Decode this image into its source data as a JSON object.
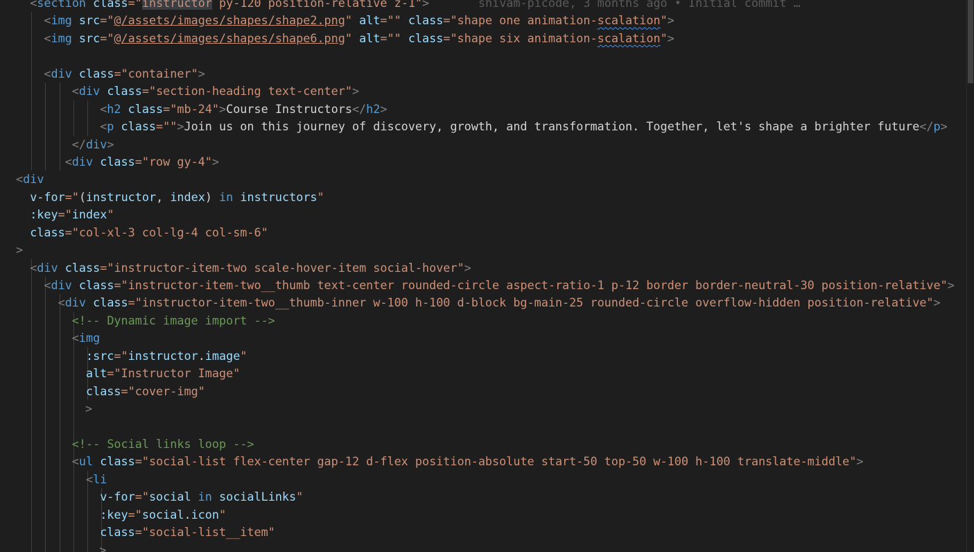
{
  "editor": {
    "language": "vue",
    "colors": {
      "background": "#1e1e1e",
      "tag": "#569cd6",
      "attribute": "#9cdcfe",
      "string": "#ce9178",
      "comment": "#6a9955",
      "punctuation": "#808080",
      "text": "#d4d4d4"
    },
    "lines": [
      {
        "indent": 1,
        "guides": 0,
        "tokens": [
          {
            "t": "<",
            "c": "punct"
          },
          {
            "t": "section",
            "c": "tag"
          },
          {
            "t": " ",
            "c": "txt"
          },
          {
            "t": "class",
            "c": "attr"
          },
          {
            "t": "=\"",
            "c": "str"
          },
          {
            "t": "instructor",
            "c": "str hl"
          },
          {
            "t": " py-120 position-relative z-1\"",
            "c": "str"
          },
          {
            "t": ">",
            "c": "punct"
          },
          {
            "t": "       shivam-picode, 3 months ago • Initial commit …",
            "c": "blame"
          }
        ]
      },
      {
        "indent": 2,
        "guides": 1,
        "tokens": [
          {
            "t": "<",
            "c": "punct"
          },
          {
            "t": "img",
            "c": "tag"
          },
          {
            "t": " ",
            "c": "txt"
          },
          {
            "t": "src",
            "c": "attr"
          },
          {
            "t": "=\"",
            "c": "str"
          },
          {
            "t": "@/assets/images/shapes/shape2.png",
            "c": "link"
          },
          {
            "t": "\"",
            "c": "str"
          },
          {
            "t": " ",
            "c": "txt"
          },
          {
            "t": "alt",
            "c": "attr"
          },
          {
            "t": "=\"\"",
            "c": "str"
          },
          {
            "t": " ",
            "c": "txt"
          },
          {
            "t": "class",
            "c": "attr"
          },
          {
            "t": "=\"shape one animation-",
            "c": "str"
          },
          {
            "t": "scalation",
            "c": "str squig"
          },
          {
            "t": "\"",
            "c": "str"
          },
          {
            "t": ">",
            "c": "punct"
          }
        ]
      },
      {
        "indent": 2,
        "guides": 1,
        "tokens": [
          {
            "t": "<",
            "c": "punct"
          },
          {
            "t": "img",
            "c": "tag"
          },
          {
            "t": " ",
            "c": "txt"
          },
          {
            "t": "src",
            "c": "attr"
          },
          {
            "t": "=\"",
            "c": "str"
          },
          {
            "t": "@/assets/images/shapes/shape6.png",
            "c": "link"
          },
          {
            "t": "\"",
            "c": "str"
          },
          {
            "t": " ",
            "c": "txt"
          },
          {
            "t": "alt",
            "c": "attr"
          },
          {
            "t": "=\"\"",
            "c": "str"
          },
          {
            "t": " ",
            "c": "txt"
          },
          {
            "t": "class",
            "c": "attr"
          },
          {
            "t": "=\"shape six animation-",
            "c": "str"
          },
          {
            "t": "scalation",
            "c": "str squig"
          },
          {
            "t": "\"",
            "c": "str"
          },
          {
            "t": ">",
            "c": "punct"
          }
        ]
      },
      {
        "indent": 0,
        "guides": 1,
        "tokens": []
      },
      {
        "indent": 2,
        "guides": 1,
        "tokens": [
          {
            "t": "<",
            "c": "punct"
          },
          {
            "t": "div",
            "c": "tag"
          },
          {
            "t": " ",
            "c": "txt"
          },
          {
            "t": "class",
            "c": "attr"
          },
          {
            "t": "=\"container\"",
            "c": "str"
          },
          {
            "t": ">",
            "c": "punct"
          }
        ]
      },
      {
        "indent": 4,
        "guides": 3,
        "tokens": [
          {
            "t": "<",
            "c": "punct"
          },
          {
            "t": "div",
            "c": "tag"
          },
          {
            "t": " ",
            "c": "txt"
          },
          {
            "t": "class",
            "c": "attr"
          },
          {
            "t": "=\"section-heading text-center\"",
            "c": "str"
          },
          {
            "t": ">",
            "c": "punct"
          }
        ]
      },
      {
        "indent": 6,
        "guides": 5,
        "tokens": [
          {
            "t": "<",
            "c": "punct"
          },
          {
            "t": "h2",
            "c": "tag"
          },
          {
            "t": " ",
            "c": "txt"
          },
          {
            "t": "class",
            "c": "attr"
          },
          {
            "t": "=\"mb-24\"",
            "c": "str"
          },
          {
            "t": ">",
            "c": "punct"
          },
          {
            "t": "Course Instructors",
            "c": "txt"
          },
          {
            "t": "</",
            "c": "punct"
          },
          {
            "t": "h2",
            "c": "tag"
          },
          {
            "t": ">",
            "c": "punct"
          }
        ]
      },
      {
        "indent": 6,
        "guides": 5,
        "tokens": [
          {
            "t": "<",
            "c": "punct"
          },
          {
            "t": "p",
            "c": "tag"
          },
          {
            "t": " ",
            "c": "txt"
          },
          {
            "t": "class",
            "c": "attr"
          },
          {
            "t": "=\"\"",
            "c": "str"
          },
          {
            "t": ">",
            "c": "punct"
          },
          {
            "t": "Join us on this journey of discovery, growth, and transformation. Together, let's shape a brighter future",
            "c": "txt"
          },
          {
            "t": "</",
            "c": "punct"
          },
          {
            "t": "p",
            "c": "tag"
          },
          {
            "t": ">",
            "c": "punct"
          }
        ]
      },
      {
        "indent": 4,
        "guides": 3,
        "tokens": [
          {
            "t": "</",
            "c": "punct"
          },
          {
            "t": "div",
            "c": "tag"
          },
          {
            "t": ">",
            "c": "punct"
          }
        ]
      },
      {
        "indent": 3.5,
        "guides": 3,
        "tokens": [
          {
            "t": "<",
            "c": "punct"
          },
          {
            "t": "div",
            "c": "tag"
          },
          {
            "t": " ",
            "c": "txt"
          },
          {
            "t": "class",
            "c": "attr"
          },
          {
            "t": "=\"row gy-4\"",
            "c": "str"
          },
          {
            "t": ">",
            "c": "punct"
          }
        ]
      },
      {
        "indent": 0,
        "guides": 0,
        "tokens": [
          {
            "t": "<",
            "c": "punct"
          },
          {
            "t": "div",
            "c": "tag"
          }
        ]
      },
      {
        "indent": 1,
        "guides": 0,
        "tokens": [
          {
            "t": "v-for",
            "c": "attr"
          },
          {
            "t": "=\"",
            "c": "str"
          },
          {
            "t": "(",
            "c": "txt"
          },
          {
            "t": "instructor",
            "c": "var"
          },
          {
            "t": ", ",
            "c": "txt"
          },
          {
            "t": "index",
            "c": "var"
          },
          {
            "t": ") ",
            "c": "txt"
          },
          {
            "t": "in",
            "c": "kw"
          },
          {
            "t": " ",
            "c": "txt"
          },
          {
            "t": "instructors",
            "c": "var"
          },
          {
            "t": "\"",
            "c": "str"
          }
        ]
      },
      {
        "indent": 1,
        "guides": 0,
        "tokens": [
          {
            "t": ":key",
            "c": "attr"
          },
          {
            "t": "=\"",
            "c": "str"
          },
          {
            "t": "index",
            "c": "var"
          },
          {
            "t": "\"",
            "c": "str"
          }
        ]
      },
      {
        "indent": 1,
        "guides": 0,
        "tokens": [
          {
            "t": "class",
            "c": "attr"
          },
          {
            "t": "=\"col-xl-3 col-lg-4 col-sm-6\"",
            "c": "str"
          }
        ]
      },
      {
        "indent": 0,
        "guides": 0,
        "tokens": [
          {
            "t": ">",
            "c": "punct"
          }
        ]
      },
      {
        "indent": 1,
        "guides": 1,
        "tokens": [
          {
            "t": "<",
            "c": "punct"
          },
          {
            "t": "div",
            "c": "tag"
          },
          {
            "t": " ",
            "c": "txt"
          },
          {
            "t": "class",
            "c": "attr"
          },
          {
            "t": "=\"instructor-item-two scale-hover-item social-hover\"",
            "c": "str"
          },
          {
            "t": ">",
            "c": "punct"
          }
        ]
      },
      {
        "indent": 2,
        "guides": 2,
        "tokens": [
          {
            "t": "<",
            "c": "punct"
          },
          {
            "t": "div",
            "c": "tag"
          },
          {
            "t": " ",
            "c": "txt"
          },
          {
            "t": "class",
            "c": "attr"
          },
          {
            "t": "=\"instructor-item-two__thumb text-center rounded-circle aspect-ratio-1 p-12 border border-neutral-30 position-relative\"",
            "c": "str"
          },
          {
            "t": ">",
            "c": "punct"
          }
        ]
      },
      {
        "indent": 3,
        "guides": 3,
        "tokens": [
          {
            "t": "<",
            "c": "punct"
          },
          {
            "t": "div",
            "c": "tag"
          },
          {
            "t": " ",
            "c": "txt"
          },
          {
            "t": "class",
            "c": "attr"
          },
          {
            "t": "=\"instructor-item-two__thumb-inner w-100 h-100 d-block bg-main-25 rounded-circle overflow-hidden position-relative\"",
            "c": "str"
          },
          {
            "t": ">",
            "c": "punct"
          }
        ]
      },
      {
        "indent": 4,
        "guides": 4,
        "tokens": [
          {
            "t": "<!-- Dynamic image import -->",
            "c": "cmt"
          }
        ]
      },
      {
        "indent": 4,
        "guides": 4,
        "tokens": [
          {
            "t": "<",
            "c": "punct"
          },
          {
            "t": "img",
            "c": "tag"
          }
        ]
      },
      {
        "indent": 5,
        "guides": 5,
        "tokens": [
          {
            "t": ":src",
            "c": "attr"
          },
          {
            "t": "=\"",
            "c": "str"
          },
          {
            "t": "instructor",
            "c": "var"
          },
          {
            "t": ".",
            "c": "txt"
          },
          {
            "t": "image",
            "c": "var"
          },
          {
            "t": "\"",
            "c": "str"
          }
        ]
      },
      {
        "indent": 5,
        "guides": 5,
        "tokens": [
          {
            "t": "alt",
            "c": "attr"
          },
          {
            "t": "=\"Instructor Image\"",
            "c": "str"
          }
        ]
      },
      {
        "indent": 5,
        "guides": 5,
        "tokens": [
          {
            "t": "class",
            "c": "attr"
          },
          {
            "t": "=\"cover-img\"",
            "c": "str"
          }
        ]
      },
      {
        "indent": 4.95,
        "guides": 4,
        "tokens": [
          {
            "t": ">",
            "c": "punct"
          }
        ]
      },
      {
        "indent": 0,
        "guides": 4,
        "tokens": []
      },
      {
        "indent": 4,
        "guides": 4,
        "tokens": [
          {
            "t": "<!-- Social links loop -->",
            "c": "cmt"
          }
        ]
      },
      {
        "indent": 4,
        "guides": 4,
        "tokens": [
          {
            "t": "<",
            "c": "punct"
          },
          {
            "t": "ul",
            "c": "tag"
          },
          {
            "t": " ",
            "c": "txt"
          },
          {
            "t": "class",
            "c": "attr"
          },
          {
            "t": "=\"social-list flex-center gap-12 d-flex position-absolute start-50 top-50 w-100 h-100 translate-middle\"",
            "c": "str"
          },
          {
            "t": ">",
            "c": "punct"
          }
        ]
      },
      {
        "indent": 5,
        "guides": 5,
        "tokens": [
          {
            "t": "<",
            "c": "punct"
          },
          {
            "t": "li",
            "c": "tag"
          }
        ]
      },
      {
        "indent": 6,
        "guides": 6,
        "tokens": [
          {
            "t": "v-for",
            "c": "attr"
          },
          {
            "t": "=\"",
            "c": "str"
          },
          {
            "t": "social",
            "c": "var"
          },
          {
            "t": " ",
            "c": "txt"
          },
          {
            "t": "in",
            "c": "kw"
          },
          {
            "t": " ",
            "c": "txt"
          },
          {
            "t": "socialLinks",
            "c": "var"
          },
          {
            "t": "\"",
            "c": "str"
          }
        ]
      },
      {
        "indent": 6,
        "guides": 6,
        "tokens": [
          {
            "t": ":key",
            "c": "attr"
          },
          {
            "t": "=\"",
            "c": "str"
          },
          {
            "t": "social",
            "c": "var"
          },
          {
            "t": ".",
            "c": "txt"
          },
          {
            "t": "icon",
            "c": "var"
          },
          {
            "t": "\"",
            "c": "str"
          }
        ]
      },
      {
        "indent": 6,
        "guides": 6,
        "tokens": [
          {
            "t": "class",
            "c": "attr"
          },
          {
            "t": "=\"social-list__item\"",
            "c": "str"
          }
        ]
      },
      {
        "indent": 5.95,
        "guides": 6,
        "tokens": [
          {
            "t": ">",
            "c": "punct"
          }
        ]
      }
    ]
  }
}
